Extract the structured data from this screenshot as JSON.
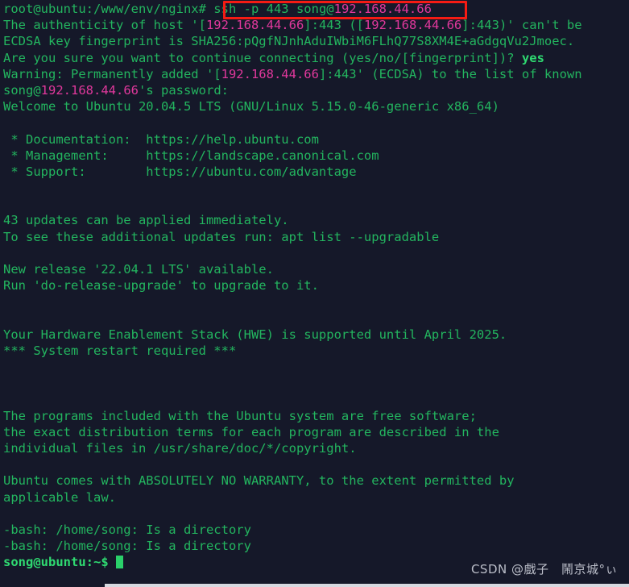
{
  "window": {
    "title": "terminal",
    "background_color": "#151829",
    "text_color": "#23b55f",
    "accent_color": "#e0389c",
    "highlight_box_color": "#f51b14"
  },
  "prompt": {
    "first": "root@ubuntu:/www/env/nginx# ",
    "last": "song@ubuntu:~$ "
  },
  "command": {
    "prefix": "ssh -p 443 song@",
    "host": "192.168.44.66",
    "full": "ssh -p 443 song@192.168.44.66"
  },
  "lines": [
    {
      "id": "l01-prompt-command",
      "segments": [
        {
          "text": "root@ubuntu:/www/env/nginx# ",
          "style": "g"
        },
        {
          "text": "ssh -p 443 song@",
          "style": "g"
        },
        {
          "text": "192.168.44.66",
          "style": "pk"
        }
      ]
    },
    {
      "id": "l02-authenticity",
      "segments": [
        {
          "text": "The authenticity of host '[",
          "style": "g"
        },
        {
          "text": "192.168.44.66",
          "style": "pk"
        },
        {
          "text": "]:443 ([",
          "style": "g"
        },
        {
          "text": "192.168.44.66",
          "style": "pk"
        },
        {
          "text": "]:443)' can't be",
          "style": "g"
        }
      ]
    },
    {
      "id": "l03-fingerprint",
      "segments": [
        {
          "text": "ECDSA key fingerprint is SHA256:pQgfNJnhAduIWbiM6FLhQ77S8XM4E+aGdgqVu2Jmoec.",
          "style": "g"
        }
      ]
    },
    {
      "id": "l04-confirm",
      "segments": [
        {
          "text": "Are you sure you want to continue connecting (yes/no/[fingerprint])? ",
          "style": "g"
        },
        {
          "text": "yes",
          "style": "gb"
        }
      ]
    },
    {
      "id": "l05-warning",
      "segments": [
        {
          "text": "Warning: Permanently added '[",
          "style": "g"
        },
        {
          "text": "192.168.44.66",
          "style": "pk"
        },
        {
          "text": "]:443' (ECDSA) to the list of known",
          "style": "g"
        }
      ]
    },
    {
      "id": "l06-password",
      "segments": [
        {
          "text": "song@",
          "style": "g"
        },
        {
          "text": "192.168.44.66",
          "style": "pk"
        },
        {
          "text": "'s password:",
          "style": "g"
        }
      ]
    },
    {
      "id": "l07-welcome",
      "segments": [
        {
          "text": "Welcome to Ubuntu 20.04.5 LTS (GNU/Linux 5.15.0-46-generic x86_64)",
          "style": "g"
        }
      ]
    },
    {
      "id": "l08-blank",
      "segments": [
        {
          "text": "",
          "style": "g"
        }
      ]
    },
    {
      "id": "l09-documentation",
      "segments": [
        {
          "text": " * Documentation:  https://help.ubuntu.com",
          "style": "g"
        }
      ]
    },
    {
      "id": "l10-management",
      "segments": [
        {
          "text": " * Management:     https://landscape.canonical.com",
          "style": "g"
        }
      ]
    },
    {
      "id": "l11-support",
      "segments": [
        {
          "text": " * Support:        https://ubuntu.com/advantage",
          "style": "g"
        }
      ]
    },
    {
      "id": "l12-blank",
      "segments": [
        {
          "text": "",
          "style": "g"
        }
      ]
    },
    {
      "id": "l13-blank",
      "segments": [
        {
          "text": "",
          "style": "g"
        }
      ]
    },
    {
      "id": "l14-updates-count",
      "segments": [
        {
          "text": "43 updates can be applied immediately.",
          "style": "g"
        }
      ]
    },
    {
      "id": "l15-updates-hint",
      "segments": [
        {
          "text": "To see these additional updates run: apt list --upgradable",
          "style": "g"
        }
      ]
    },
    {
      "id": "l16-blank",
      "segments": [
        {
          "text": "",
          "style": "g"
        }
      ]
    },
    {
      "id": "l17-new-release",
      "segments": [
        {
          "text": "New release '22.04.1 LTS' available.",
          "style": "g"
        }
      ]
    },
    {
      "id": "l18-do-release-upgrade",
      "segments": [
        {
          "text": "Run 'do-release-upgrade' to upgrade to it.",
          "style": "g"
        }
      ]
    },
    {
      "id": "l19-blank",
      "segments": [
        {
          "text": "",
          "style": "g"
        }
      ]
    },
    {
      "id": "l20-blank",
      "segments": [
        {
          "text": "",
          "style": "g"
        }
      ]
    },
    {
      "id": "l21-hwe",
      "segments": [
        {
          "text": "Your Hardware Enablement Stack (HWE) is supported until April 2025.",
          "style": "g"
        }
      ]
    },
    {
      "id": "l22-restart-required",
      "segments": [
        {
          "text": "*** System restart required ***",
          "style": "g"
        }
      ]
    },
    {
      "id": "l23-blank",
      "segments": [
        {
          "text": "",
          "style": "g"
        }
      ]
    },
    {
      "id": "l24-blank",
      "segments": [
        {
          "text": "",
          "style": "g"
        }
      ]
    },
    {
      "id": "l25-blank",
      "segments": [
        {
          "text": "",
          "style": "g"
        }
      ]
    },
    {
      "id": "l26-programs-1",
      "segments": [
        {
          "text": "The programs included with the Ubuntu system are free software;",
          "style": "g"
        }
      ]
    },
    {
      "id": "l27-programs-2",
      "segments": [
        {
          "text": "the exact distribution terms for each program are described in the",
          "style": "g"
        }
      ]
    },
    {
      "id": "l28-programs-3",
      "segments": [
        {
          "text": "individual files in /usr/share/doc/*/copyright.",
          "style": "g"
        }
      ]
    },
    {
      "id": "l29-blank",
      "segments": [
        {
          "text": "",
          "style": "g"
        }
      ]
    },
    {
      "id": "l30-warranty-1",
      "segments": [
        {
          "text": "Ubuntu comes with ABSOLUTELY NO WARRANTY, to the extent permitted by",
          "style": "g"
        }
      ]
    },
    {
      "id": "l31-warranty-2",
      "segments": [
        {
          "text": "applicable law.",
          "style": "g"
        }
      ]
    },
    {
      "id": "l32-blank",
      "segments": [
        {
          "text": "",
          "style": "g"
        }
      ]
    },
    {
      "id": "l33-bash-error-1",
      "segments": [
        {
          "text": "-bash: /home/song: Is a directory",
          "style": "g"
        }
      ]
    },
    {
      "id": "l34-bash-error-2",
      "segments": [
        {
          "text": "-bash: /home/song: Is a directory",
          "style": "g"
        }
      ]
    },
    {
      "id": "l35-final-prompt",
      "segments": [
        {
          "text": "song@ubuntu:~$ ",
          "style": "gb"
        }
      ],
      "cursor": true
    }
  ],
  "watermark": {
    "text": "CSDN @戲子　鬧京城°ぃ",
    "color": "#c9ccd6"
  }
}
